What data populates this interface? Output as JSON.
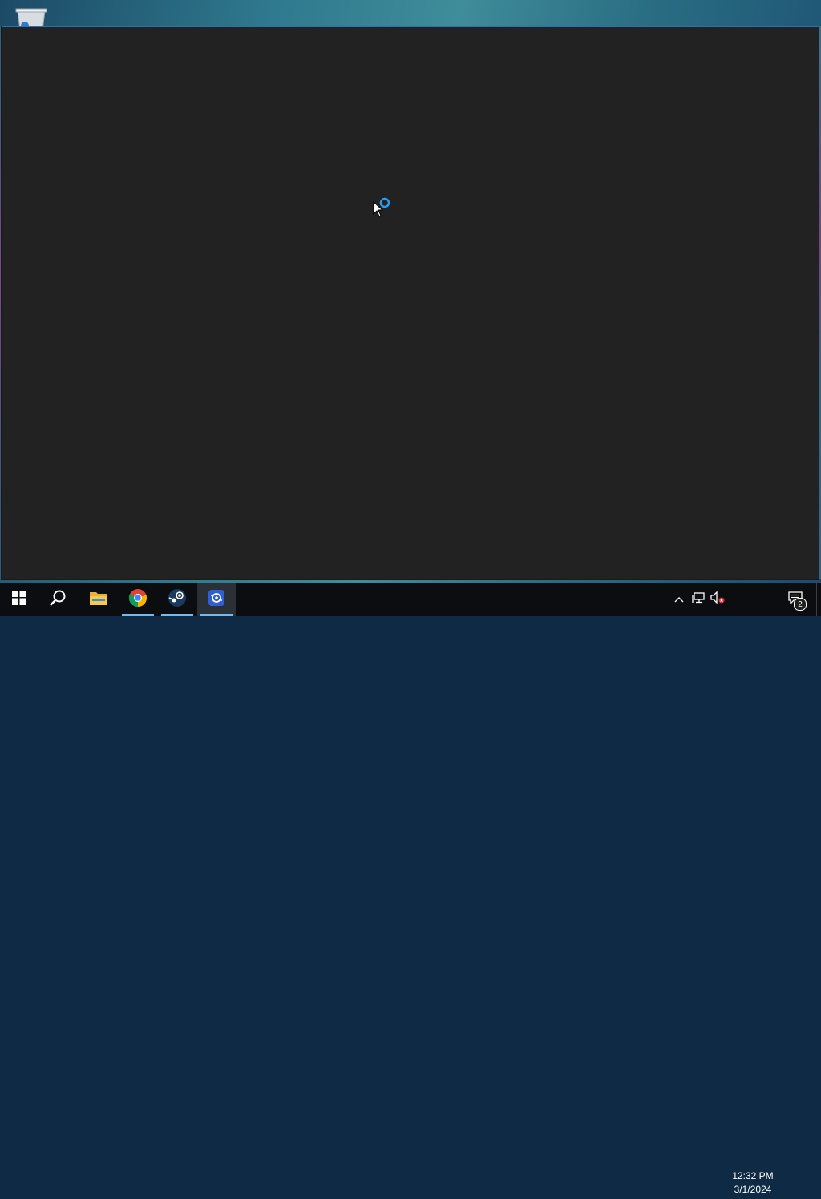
{
  "desktop": {
    "icons": [
      {
        "name": "recycle-bin-icon"
      }
    ]
  },
  "window": {
    "state": "loading",
    "spinner_icon": "loading-spinner-icon"
  },
  "taskbar": {
    "start_icon": "windows-logo-icon",
    "search_icon": "search-icon",
    "pinned": [
      {
        "name": "file-explorer-icon",
        "running": false
      },
      {
        "name": "chrome-icon",
        "running": true
      },
      {
        "name": "steam-icon",
        "running": true
      },
      {
        "name": "app-icon",
        "running": true,
        "focused": true
      }
    ],
    "tray": {
      "icons": [
        "chevron-up-icon",
        "network-icon",
        "volume-muted-icon"
      ],
      "time": "12:32 PM",
      "date": "3/1/2024",
      "notification_count": "2"
    }
  },
  "colors": {
    "accent": "#76b9ed",
    "window_bg": "#222222",
    "taskbar_bg": "#0b0d10"
  }
}
